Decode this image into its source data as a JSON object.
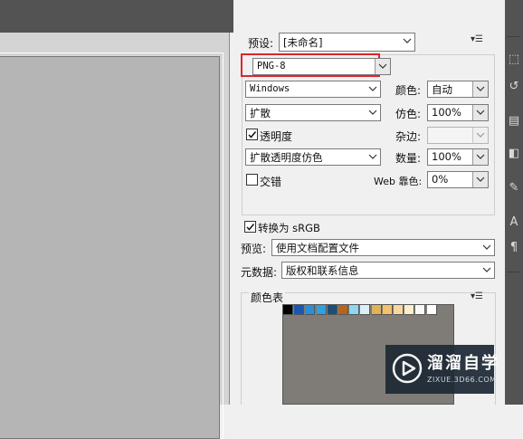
{
  "settings": {
    "preset_label": "预设:",
    "preset_value": "[未命名]",
    "format_value": "PNG-8",
    "palette_value": "Windows",
    "colors_label": "颜色:",
    "colors_value": "自动",
    "dither_algo_value": "扩散",
    "dither_label": "仿色:",
    "dither_value": "100%",
    "transparency_label": "透明度",
    "transparency_checked": true,
    "matte_label": "杂边:",
    "matte_value": "",
    "transparency_dither_value": "扩散透明度仿色",
    "amount_label": "数量:",
    "amount_value": "100%",
    "interlaced_label": "交错",
    "interlaced_checked": false,
    "web_snap_label": "Web 靠色:",
    "web_snap_value": "0%",
    "convert_srgb_label": "转换为 sRGB",
    "convert_srgb_checked": true,
    "preview_label": "预览:",
    "preview_value": "使用文档配置文件",
    "metadata_label": "元数据:",
    "metadata_value": "版权和联系信息"
  },
  "color_table": {
    "title": "颜色表",
    "swatches": [
      "#000000",
      "#1a56b4",
      "#2b8fd6",
      "#2fa0e0",
      "#1c4f78",
      "#b5651d",
      "#8fd6f0",
      "#d9f2f7",
      "#e0b25c",
      "#f5c26b",
      "#f6d9a0",
      "#fbeec9",
      "#f8f8f8",
      "#ffffff"
    ]
  },
  "watermark": {
    "title": "溜溜自学",
    "subtitle": "ZIXUE.3D66.COM"
  },
  "colors": {
    "highlight": "#d9272e",
    "panel_bg": "#f0f0f0",
    "dark_chrome": "#535353"
  }
}
